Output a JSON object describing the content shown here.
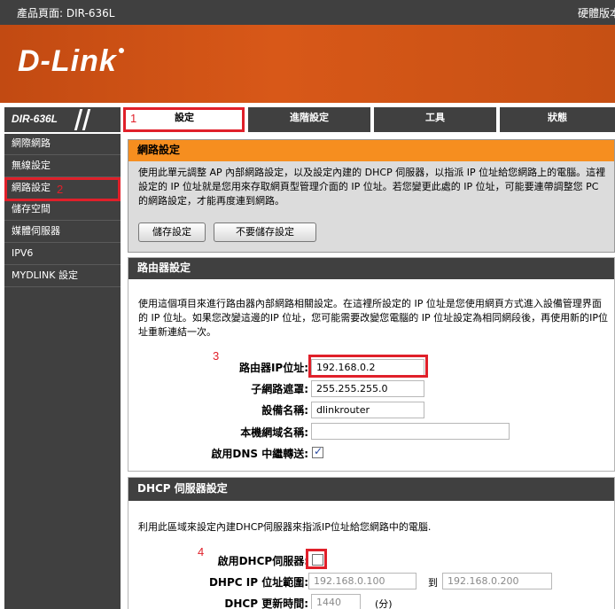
{
  "topbar": {
    "product": "產品頁面: DIR-636L",
    "hardware": "硬體版本"
  },
  "banner": {
    "logo": "D-Link"
  },
  "model": "DIR-636L",
  "tabs": [
    {
      "label": "設定",
      "active": true
    },
    {
      "label": "進階設定",
      "active": false
    },
    {
      "label": "工具",
      "active": false
    },
    {
      "label": "狀態",
      "active": false
    }
  ],
  "nav": [
    {
      "label": "網際網路"
    },
    {
      "label": "無線設定"
    },
    {
      "label": "網路設定",
      "active": true
    },
    {
      "label": "儲存空間"
    },
    {
      "label": "媒體伺服器"
    },
    {
      "label": "IPV6"
    },
    {
      "label": "MYDLINK 設定"
    }
  ],
  "network_settings": {
    "title": "網路設定",
    "description": "使用此單元調整 AP 內部網路設定，以及設定內建的 DHCP 伺服器，以指派 IP 位址給您網路上的電腦。這裡設定的 IP 位址就是您用來存取網頁型管理介面的 IP 位址。若您變更此處的 IP 位址，可能要連帶調整您 PC 的網路設定，才能再度連到網路。",
    "save_button": "儲存設定",
    "dont_save_button": "不要儲存設定"
  },
  "router_settings": {
    "title": "路由器設定",
    "description": "使用這個項目來進行路由器內部網路相關設定。在這裡所設定的 IP 位址是您使用網頁方式進入設備管理界面的 IP 位址。如果您改變這邊的IP 位址，您可能需要改變您電腦的 IP 位址設定為相同網段後，再使用新的IP位址重新連結一次。",
    "ip_label": "路由器IP位址:",
    "ip_value": "192.168.0.2",
    "mask_label": "子網路遮罩:",
    "mask_value": "255.255.255.0",
    "device_label": "設備名稱:",
    "device_value": "dlinkrouter",
    "domain_label": "本機網域名稱:",
    "domain_value": "",
    "dns_relay_label": "啟用DNS 中繼轉送:",
    "dns_relay_checked": true
  },
  "dhcp_settings": {
    "title": "DHCP 伺服器設定",
    "description": "利用此區域來設定內建DHCP伺服器來指派IP位址給您網路中的電腦.",
    "enable_label": "啟用DHCP伺服器:",
    "enable_checked": false,
    "range_label": "DHPC IP 位址範圍:",
    "range_start": "192.168.0.100",
    "range_to": "到",
    "range_end": "192.168.0.200",
    "lease_label": "DHCP 更新時間:",
    "lease_value": "1440",
    "lease_unit": "(分)"
  },
  "annotations": [
    "1",
    "2",
    "3",
    "4"
  ],
  "colors": {
    "accent_orange": "#f68e1f",
    "dark_gray": "#404040",
    "annotation_red": "#e0202a"
  }
}
